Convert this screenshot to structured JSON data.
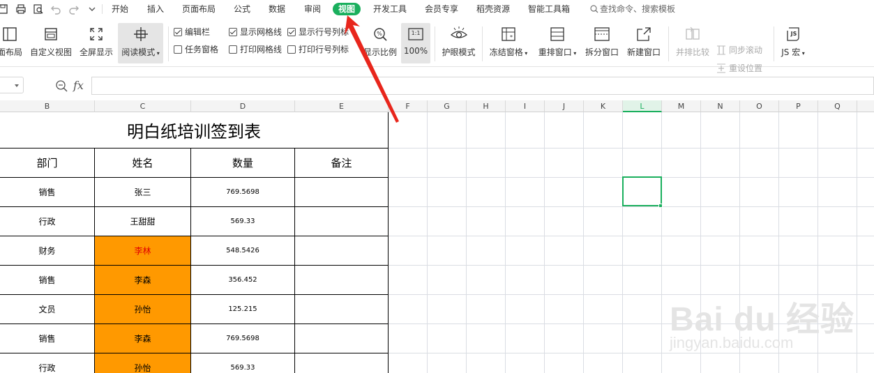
{
  "menu": {
    "tabs": [
      "开始",
      "插入",
      "页面布局",
      "公式",
      "数据",
      "审阅",
      "视图",
      "开发工具",
      "会员专享",
      "稻壳资源",
      "智能工具箱"
    ],
    "active": "视图",
    "search_placeholder": "查找命令、搜索模板"
  },
  "ribbon": {
    "page_layout": "面布局",
    "custom_view": "自定义视图",
    "fullscreen": "全屏显示",
    "reading_mode": "阅读模式",
    "edit_bar": "编辑栏",
    "task_pane": "任务窗格",
    "show_gridlines": "显示网格线",
    "print_gridlines": "打印网格线",
    "show_headers": "显示行号列标",
    "print_headers": "打印行号列标",
    "zoom_ratio": "显示比例",
    "zoom_100": "100%",
    "zoom_100_icon_text": "1:1",
    "eye_mode": "护眼模式",
    "freeze": "冻结窗格",
    "arrange": "重排窗口",
    "split": "拆分窗口",
    "new_window": "新建窗口",
    "side_by_side": "并排比较",
    "sync_scroll": "同步滚动",
    "reset_position": "重设位置",
    "js_macro": "JS 宏"
  },
  "checkboxes": {
    "edit_bar": true,
    "task_pane": false,
    "show_gridlines": true,
    "print_gridlines": false,
    "show_headers": true,
    "print_headers": false
  },
  "formula_bar": {
    "fx": "fx",
    "value": ""
  },
  "columns": [
    "B",
    "C",
    "D",
    "E",
    "F",
    "G",
    "H",
    "I",
    "J",
    "K",
    "L",
    "M",
    "N",
    "O",
    "P",
    "Q"
  ],
  "selected_column": "L",
  "sheet": {
    "title": "明白纸培训签到表",
    "headers": [
      "部门",
      "姓名",
      "数量",
      "备注"
    ],
    "rows": [
      {
        "dept": "销售",
        "name": "张三",
        "qty": "769.5698",
        "note": ""
      },
      {
        "dept": "行政",
        "name": "王甜甜",
        "qty": "569.33",
        "note": ""
      },
      {
        "dept": "财务",
        "name": "李林",
        "qty": "548.5426",
        "note": ""
      },
      {
        "dept": "销售",
        "name": "李森",
        "qty": "356.452",
        "note": ""
      },
      {
        "dept": "文员",
        "name": "孙怡",
        "qty": "125.215",
        "note": ""
      },
      {
        "dept": "销售",
        "name": "李森",
        "qty": "769.5698",
        "note": ""
      },
      {
        "dept": "行政",
        "name": "孙怡",
        "qty": "569.33",
        "note": ""
      }
    ]
  },
  "watermark": {
    "main": "Bai du 经验",
    "sub": "jingyan.baidu.com"
  },
  "colors": {
    "accent": "#1aaf5d",
    "highlight": "#ff9900",
    "red_text": "#e00000",
    "annotation_arrow": "#e8261c"
  }
}
